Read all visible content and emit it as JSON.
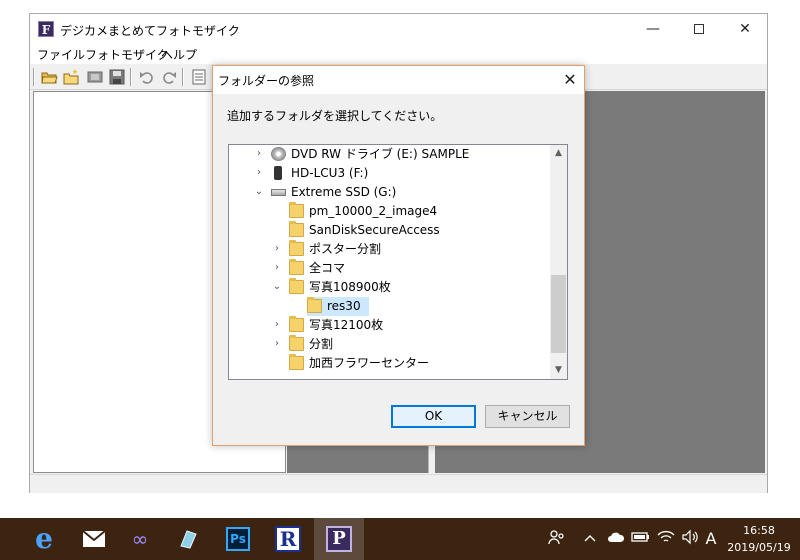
{
  "app": {
    "title": "デジカメまとめてフォトモザイク",
    "icon_letter": "F",
    "controls": {
      "minimize": "—",
      "close": "✕"
    }
  },
  "menu": {
    "file": "ファイル",
    "mosaic": "フォトモザイク",
    "help": "ヘルプ"
  },
  "toolbar": {
    "icons": [
      "open-folder-icon",
      "new-folder-icon",
      "film-icon",
      "save-icon",
      "undo-icon",
      "redo-icon",
      "list-icon"
    ]
  },
  "dialog": {
    "title": "フォルダーの参照",
    "close": "✕",
    "instruction": "追加するフォルダを選択してください。",
    "tree": [
      {
        "label": "DVD RW ドライブ (E:) SAMPLE",
        "icon": "disc-icon",
        "level": 0,
        "arrow": "›"
      },
      {
        "label": "HD-LCU3 (F:)",
        "icon": "hdd-icon",
        "level": 0,
        "arrow": "›"
      },
      {
        "label": "Extreme SSD (G:)",
        "icon": "ssd-icon",
        "level": 0,
        "arrow": "⌄"
      },
      {
        "label": "pm_10000_2_image4",
        "icon": "folder-icon",
        "level": 1,
        "arrow": ""
      },
      {
        "label": "SanDiskSecureAccess",
        "icon": "folder-icon",
        "level": 1,
        "arrow": ""
      },
      {
        "label": "ポスター分割",
        "icon": "folder-icon",
        "level": 1,
        "arrow": "›"
      },
      {
        "label": "全コマ",
        "icon": "folder-icon",
        "level": 1,
        "arrow": "›"
      },
      {
        "label": "写真108900枚",
        "icon": "folder-icon",
        "level": 1,
        "arrow": "⌄"
      },
      {
        "label": "res30",
        "icon": "folder-icon",
        "level": 2,
        "arrow": "",
        "selected": true
      },
      {
        "label": "写真12100枚",
        "icon": "folder-icon",
        "level": 1,
        "arrow": "›"
      },
      {
        "label": "分割",
        "icon": "folder-icon",
        "level": 1,
        "arrow": "›"
      },
      {
        "label": "加西フラワーセンター",
        "icon": "folder-icon",
        "level": 1,
        "arrow": ""
      }
    ],
    "scroll_up": "▲",
    "scroll_down": "▼",
    "ok_label": "OK",
    "cancel_label": "キャンセル"
  },
  "taskbar": {
    "apps": [
      "edge-icon",
      "mail-icon",
      "infinity-icon",
      "app-icon",
      "photoshop-icon",
      "r-app-icon",
      "photomosaic-app-icon"
    ],
    "ps_label": "Ps",
    "r_label": "R",
    "p_label": "P",
    "tray": {
      "ime": "A",
      "time": "16:58",
      "date": "2019/05/19"
    }
  }
}
